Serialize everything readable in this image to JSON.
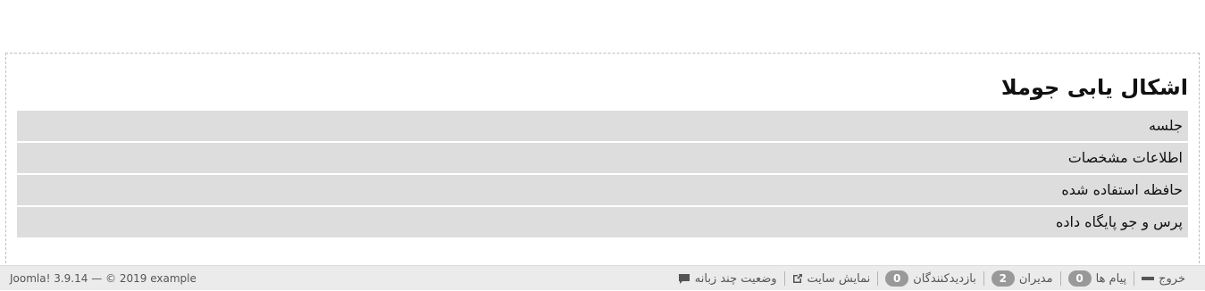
{
  "debug": {
    "title": "اشکال یابی جوملا",
    "sections": [
      {
        "label": "جلسه"
      },
      {
        "label": "اطلاعات مشخصات"
      },
      {
        "label": "حافظه استفاده شده"
      },
      {
        "label": "پرس و جو پایگاه داده"
      }
    ]
  },
  "status_bar": {
    "multilingual_label": "وضعیت چند زبانه",
    "view_site_label": "نمایش سایت",
    "visitors_count": "0",
    "visitors_label": "بازدیدکنندگان",
    "admins_count": "2",
    "admins_label": "مدیران",
    "messages_count": "0",
    "messages_label": "پیام ها",
    "logout_label": "خروج",
    "copyright": "Joomla! 3.9.14 — © 2019 example",
    "icons": {
      "multilingual": "comment-icon",
      "view_site": "external-link-icon",
      "logout": "minus-icon"
    }
  }
}
